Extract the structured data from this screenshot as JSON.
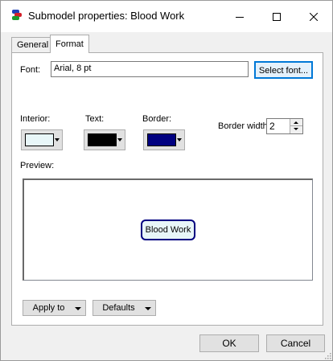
{
  "window": {
    "title": "Submodel properties: Blood Work"
  },
  "titlebar": {
    "minimize_icon": "minimize-icon",
    "maximize_icon": "maximize-icon",
    "close_icon": "close-icon"
  },
  "tabs": [
    {
      "label": "General",
      "selected": false
    },
    {
      "label": "Format",
      "selected": true
    }
  ],
  "format": {
    "font_label": "Font:",
    "font_value": "Arial, 8 pt",
    "select_font_label": "Select font...",
    "interior_label": "Interior:",
    "text_label": "Text:",
    "border_label": "Border:",
    "interior_color": "#e8f6f8",
    "text_color": "#000000",
    "border_color": "#000080",
    "border_width_label": "Border width:",
    "border_width_value": "2",
    "preview_label": "Preview:",
    "preview_node_text": "Blood Work",
    "apply_to_label": "Apply to",
    "defaults_label": "Defaults"
  },
  "footer": {
    "ok_label": "OK",
    "cancel_label": "Cancel"
  }
}
